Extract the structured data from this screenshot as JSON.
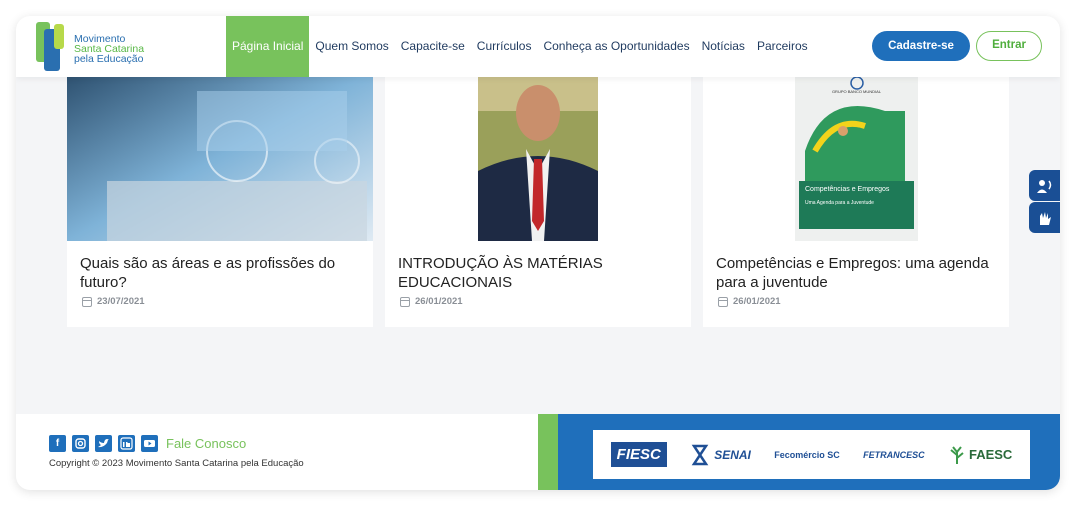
{
  "header": {
    "logo": {
      "line1": "Movimento",
      "line2": "Santa Catarina",
      "line3": "pela Educação"
    },
    "nav": [
      "Página Inicial",
      "Quem Somos",
      "Capacite-se",
      "Currículos",
      "Conheça as Oportunidades",
      "Notícias",
      "Parceiros"
    ],
    "signup_label": "Cadastre-se",
    "login_label": "Entrar"
  },
  "cards": [
    {
      "title": "Quais são as áreas e as profissões do futuro?",
      "date": "23/07/2021"
    },
    {
      "title": "INTRODUÇÃO ÀS MATÉRIAS EDUCACIONAIS",
      "date": "26/01/2021"
    },
    {
      "title": "Competências e Empregos: uma agenda para a juventude",
      "date": "26/01/2021"
    }
  ],
  "book_cover": {
    "publisher": "GRUPO BANCO MUNDIAL",
    "title": "Competências e Empregos",
    "subtitle": "Uma Agenda para a Juventude"
  },
  "footer": {
    "social": [
      "facebook-icon",
      "instagram-icon",
      "twitter-icon",
      "linkedin-icon",
      "youtube-icon"
    ],
    "contact_label": "Fale Conosco",
    "copyright": "Copyright © 2023 Movimento Santa Catarina pela Educação",
    "partners": [
      "FIESC",
      "SENAI",
      "Fecomércio SC",
      "FETRANCESC",
      "FAESC"
    ]
  },
  "colors": {
    "primary_blue": "#1f6fbb",
    "accent_green": "#78c25c",
    "navy": "#1a4f95"
  }
}
